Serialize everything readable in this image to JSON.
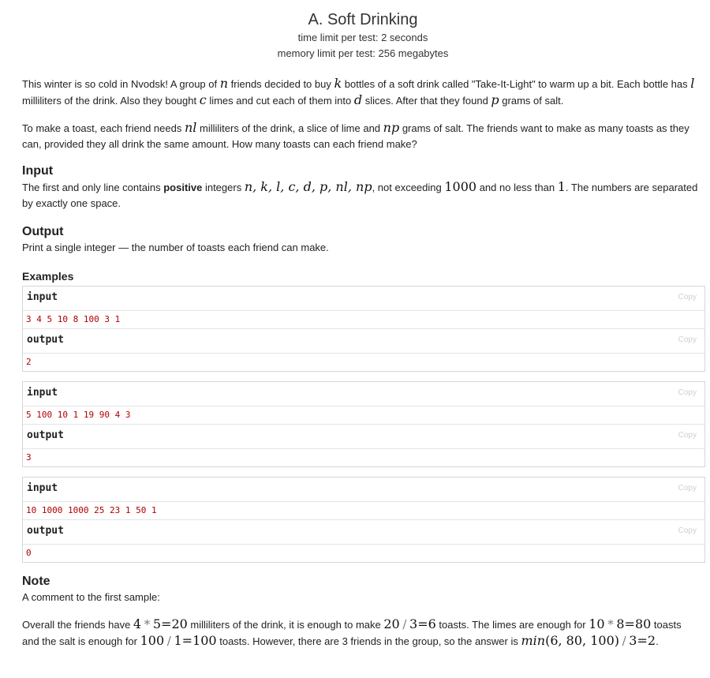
{
  "problem": {
    "title": "A. Soft Drinking",
    "time_limit": "time limit per test: 2 seconds",
    "memory_limit": "memory limit per test: 256 megabytes"
  },
  "statement": {
    "p1": {
      "t0": "This winter is so cold in Nvodsk! A group of ",
      "v_n": "n",
      "t1": " friends decided to buy ",
      "v_k": "k",
      "t2": " bottles of a soft drink called \"Take-It-Light\" to warm up a bit. Each bottle has ",
      "v_l": "l",
      "t3": " milliliters of the drink. Also they bought ",
      "v_c": "c",
      "t4": " limes and cut each of them into ",
      "v_d": "d",
      "t5": " slices. After that they found ",
      "v_p": "p",
      "t6": " grams of salt."
    },
    "p2": {
      "t0": "To make a toast, each friend needs ",
      "v_nl": "nl",
      "t1": " milliliters of the drink, a slice of lime and ",
      "v_np": "np",
      "t2": " grams of salt. The friends want to make as many toasts as they can, provided they all drink the same amount. How many toasts can each friend make?"
    }
  },
  "input_section": {
    "title": "Input",
    "t0": "The first and only line contains ",
    "bold": "positive",
    "t1": " integers ",
    "vars": "n, k, l, c, d, p, nl, np",
    "t2": ", not exceeding ",
    "max": "1000",
    "t3": " and no less than ",
    "min": "1",
    "t4": ". The numbers are separated by exactly one space."
  },
  "output_section": {
    "title": "Output",
    "text": "Print a single integer — the number of toasts each friend can make."
  },
  "examples": {
    "title": "Examples",
    "input_label": "input",
    "output_label": "output",
    "copy_label": "Copy",
    "items": [
      {
        "input": "3 4 5 10 8 100 3 1",
        "output": "2"
      },
      {
        "input": "5 100 10 1 19 90 4 3",
        "output": "3"
      },
      {
        "input": "10 1000 1000 25 23 1 50 1",
        "output": "0"
      }
    ]
  },
  "note": {
    "title": "Note",
    "p1": "A comment to the first sample:",
    "p2": {
      "t0": "Overall the friends have ",
      "a1": "4",
      "op1": "*",
      "a2": "5",
      "eq1": "=",
      "a3": "20",
      "t1": " milliliters of the drink, it is enough to make ",
      "b1": "20",
      "op2": "/",
      "b2": "3",
      "eq2": "=",
      "b3": "6",
      "t2": " toasts. The limes are enough for ",
      "c1": "10",
      "op3": "*",
      "c2": "8",
      "eq3": "=",
      "c3": "80",
      "t3": " toasts and the salt is enough for ",
      "d1": "100",
      "op4": "/",
      "d2": "1",
      "eq4": "=",
      "d3": "100",
      "t4": " toasts. However, there are 3 friends in the group, so the answer is ",
      "fn": "min",
      "args": "(6, 80, 100)",
      "op5": "/",
      "e2": "3",
      "eq5": "=",
      "e3": "2",
      "t5": "."
    }
  }
}
